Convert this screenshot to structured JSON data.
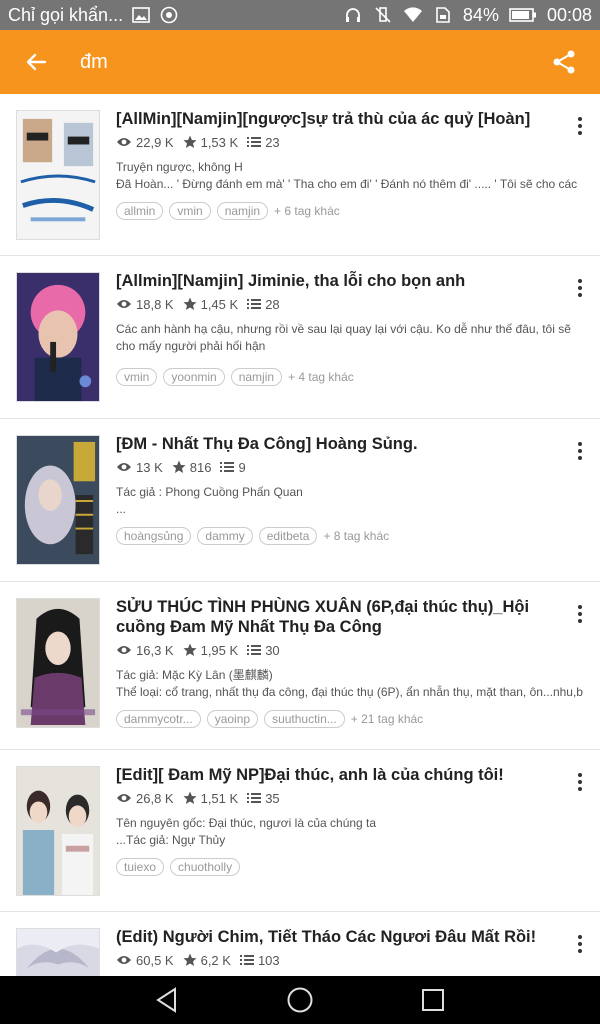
{
  "status_bar": {
    "notification": "Chỉ gọi khẩn...",
    "battery": "84%",
    "time": "00:08"
  },
  "app_bar": {
    "title": "đm"
  },
  "stories": [
    {
      "title": "[AllMin][Namjin][ngược]sự trả thù của ác quỷ [Hoàn]",
      "views": "22,9 K",
      "votes": "1,53 K",
      "parts": "23",
      "desc": [
        "Truyện ngược, không H",
        "Đã Hoàn...  ' Đừng đánh em mà' ' Tha cho em đi' ' Đánh nó thêm đi' .....  ' Tôi sẽ cho các"
      ],
      "tags": [
        "allmin",
        "vmin",
        "namjin"
      ],
      "more_tags": "+ 6 tag khác"
    },
    {
      "title": "[Allmin][Namjin] Jiminie, tha lỗi cho bọn anh",
      "views": "18,8 K",
      "votes": "1,45 K",
      "parts": "28",
      "desc": [
        "Các anh hành hạ cậu, nhưng rồi về sau lại quay lại với cậu. Ko dễ như thế đâu, tôi sẽ cho mấy người phải hối hận"
      ],
      "tags": [
        "vmin",
        "yoonmin",
        "namjin"
      ],
      "more_tags": "+ 4 tag khác"
    },
    {
      "title": "[ĐM - Nhất Thụ Đa Công] Hoàng Sủng.",
      "views": "13 K",
      "votes": "816",
      "parts": "9",
      "desc": [
        "Tác giả : Phong Cuồng Phấn Quan",
        "..."
      ],
      "tags": [
        "hoàngsủng",
        "dammy",
        "editbeta"
      ],
      "more_tags": "+ 8 tag khác"
    },
    {
      "title": "SỬU THÚC TÌNH PHÙNG XUÂN (6P,đại thúc thụ)_Hội cuồng Đam Mỹ Nhất Thụ Đa Công",
      "views": "16,3 K",
      "votes": "1,95 K",
      "parts": "30",
      "desc": [
        "Tác giả: Mặc Kỳ Lân (墨麒麟)",
        "Thể loại: cổ trang, nhất thụ đa công, đại thúc thụ (6P), ẩn nhẫn thụ, mặt than, ôn...nhu,b"
      ],
      "tags": [
        "dammycotr...",
        "yaoinp",
        "suuthuctin..."
      ],
      "more_tags": "+ 21 tag khác"
    },
    {
      "title": "[Edit][ Đam Mỹ NP]Đại thúc, anh là của chúng tôi!",
      "views": "26,8 K",
      "votes": "1,51 K",
      "parts": "35",
      "desc": [
        "Tên nguyên gốc: Đại thúc, ngươi là của chúng ta",
        "...Tác giả: Ngự Thủy"
      ],
      "tags": [
        "tuiexo",
        "chuotholly"
      ],
      "more_tags": ""
    },
    {
      "title": "(Edit) Người Chim, Tiết Tháo Các Ngươi Đâu Mất Rồi!",
      "views": "60,5 K",
      "votes": "6,2 K",
      "parts": "103",
      "desc": [],
      "tags": [],
      "more_tags": ""
    }
  ],
  "icons": {
    "back": "arrow-left-icon",
    "share": "share-icon",
    "views": "eye-icon",
    "votes": "star-icon",
    "parts": "list-icon",
    "menu": "more-vertical-icon"
  },
  "colors": {
    "accent": "#f7941d",
    "status_bar": "#757575",
    "nav_bar": "#000000"
  }
}
